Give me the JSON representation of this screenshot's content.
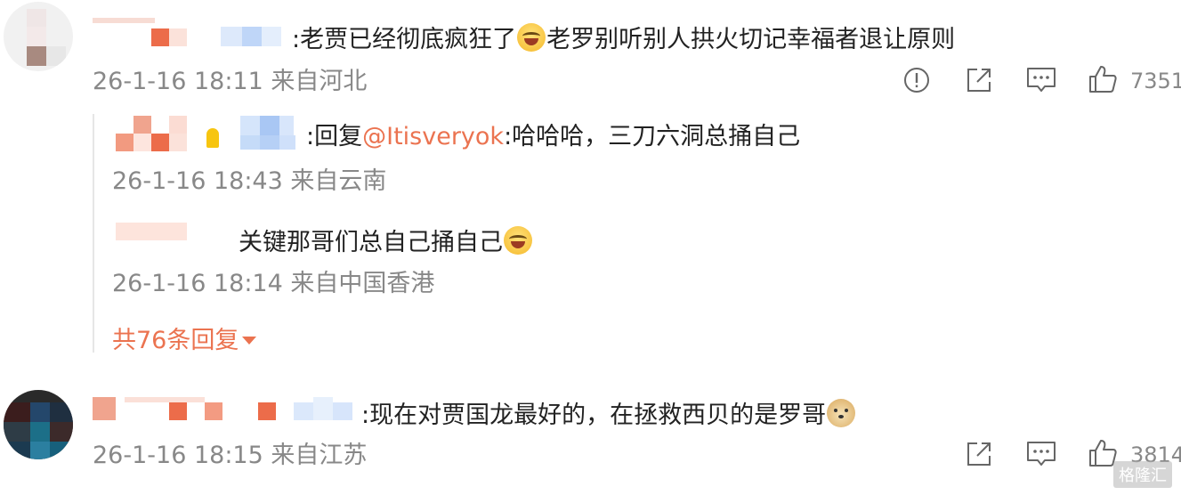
{
  "comments": [
    {
      "text": ":老贾已经彻底疯狂了",
      "text_after": "老罗别听别人拱火切记幸福者退让原则",
      "time": "26-1-16 18:11",
      "location": "来自河北",
      "likes": "7351"
    },
    {
      "text": ":现在对贾国龙最好的，在拯救西贝的是罗哥",
      "time": "26-1-16 18:15",
      "location": "来自江苏",
      "likes": "3814"
    }
  ],
  "replies": [
    {
      "prefix": ":回复",
      "mention": "@Itisveryok",
      "text": ":哈哈哈，三刀六洞总捅自己",
      "time": "26-1-16 18:43",
      "location": "来自云南"
    },
    {
      "text": "关键那哥们总自己捅自己",
      "time": "26-1-16 18:14",
      "location": "来自中国香港"
    }
  ],
  "more_replies": "共76条回复",
  "icons": {
    "report": "report-icon",
    "share": "share-icon",
    "comment": "comment-icon",
    "like": "like-icon",
    "emoji_laugh": "laugh-cry-emoji",
    "emoji_doge": "doge-emoji"
  },
  "colors": {
    "accent": "#eb7350",
    "meta": "#888888",
    "text": "#222222"
  },
  "watermark": "格隆汇"
}
